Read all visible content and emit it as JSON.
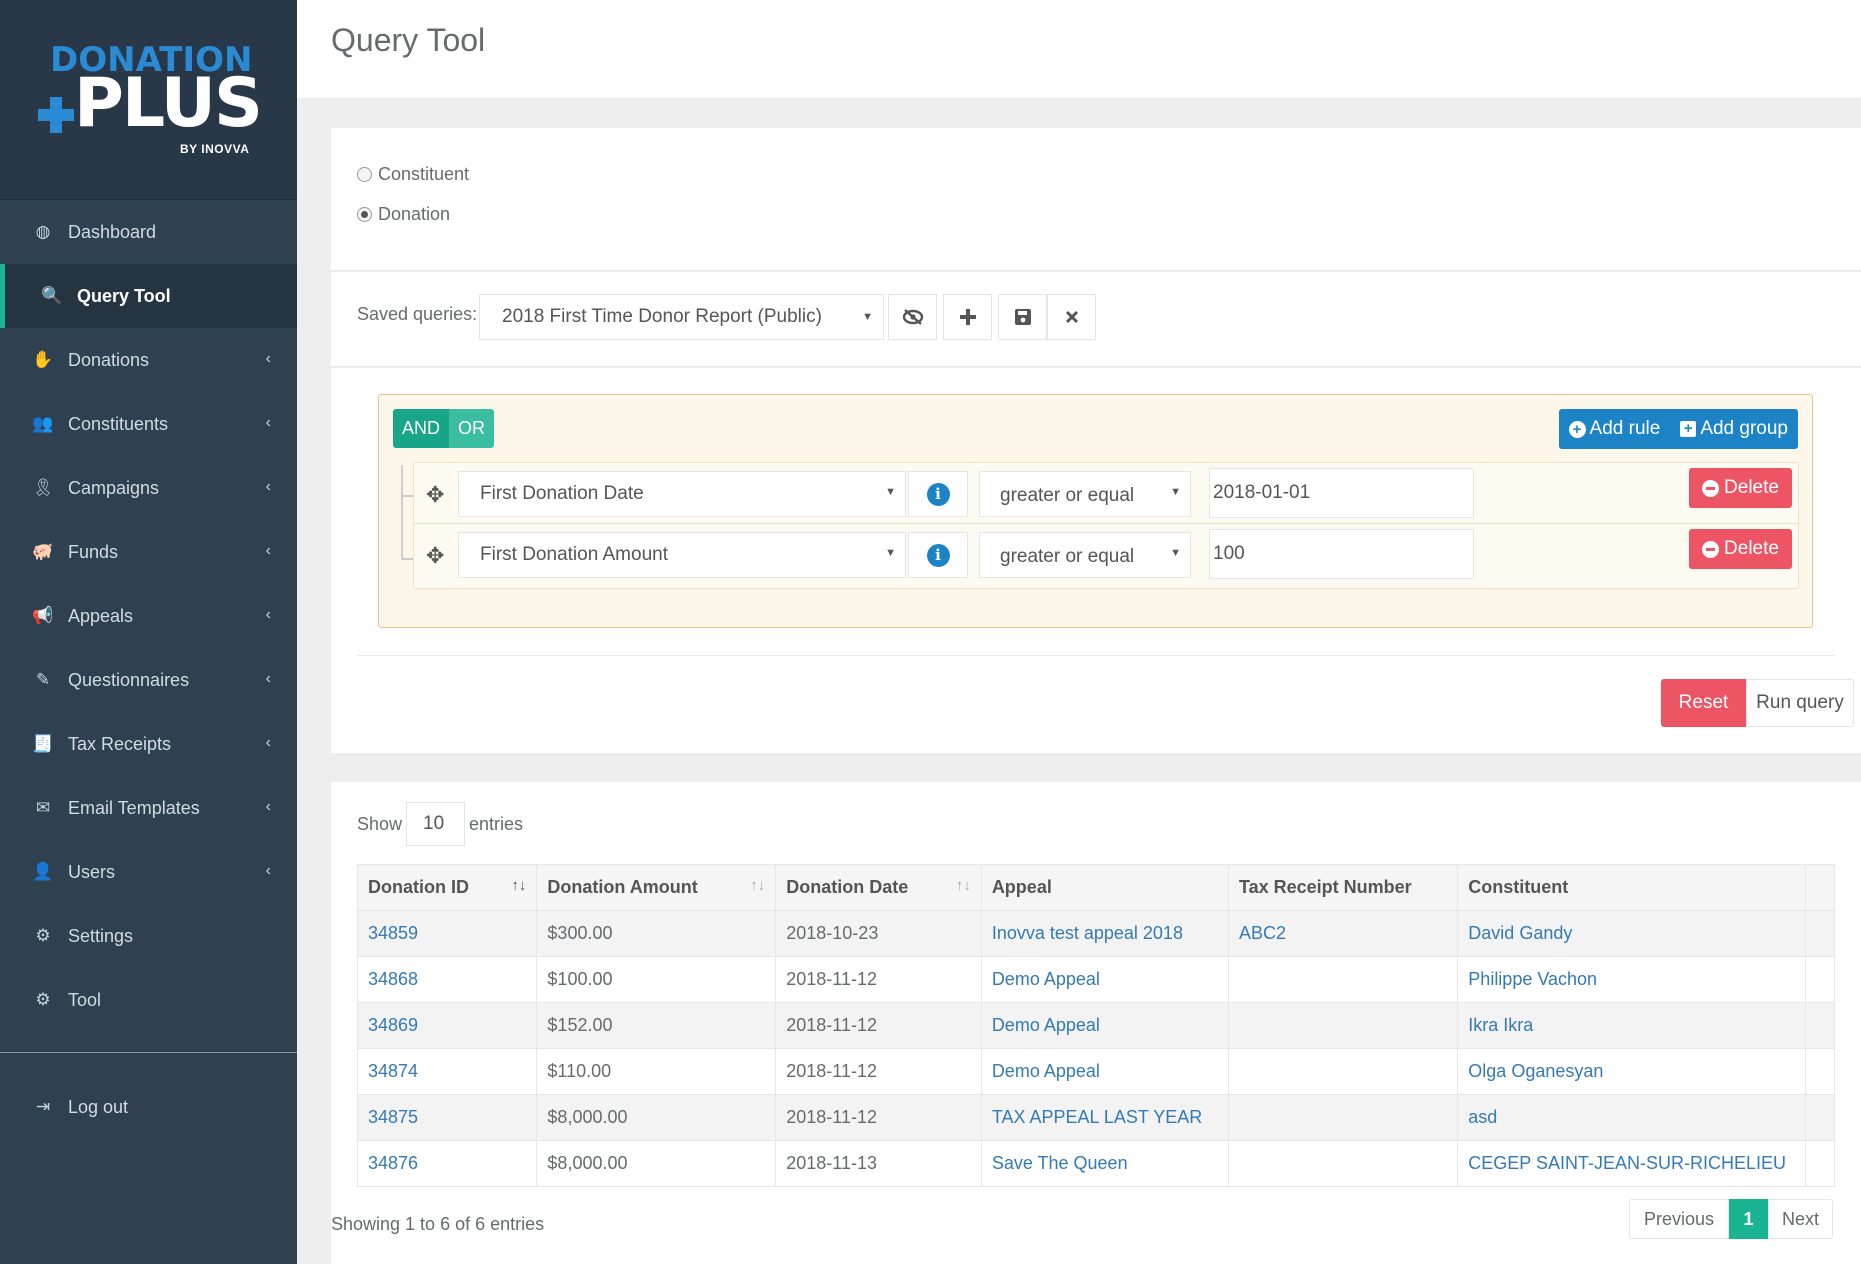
{
  "brand": {
    "line1": "DONATION",
    "line2": "PLUS",
    "byline": "BY INOVVA"
  },
  "sidebar": {
    "items": [
      {
        "label": "Dashboard",
        "icon": "dashboard-icon",
        "glyph": "◍",
        "chevron": false,
        "active": false
      },
      {
        "label": "Query Tool",
        "icon": "search-icon",
        "glyph": "🔍",
        "chevron": false,
        "active": true
      },
      {
        "label": "Donations",
        "icon": "hand-donation-icon",
        "glyph": "✋",
        "chevron": true,
        "active": false
      },
      {
        "label": "Constituents",
        "icon": "users-icon",
        "glyph": "👥",
        "chevron": true,
        "active": false
      },
      {
        "label": "Campaigns",
        "icon": "ribbon-icon",
        "glyph": "🎗",
        "chevron": true,
        "active": false
      },
      {
        "label": "Funds",
        "icon": "piggy-bank-icon",
        "glyph": "🐖",
        "chevron": true,
        "active": false
      },
      {
        "label": "Appeals",
        "icon": "megaphone-icon",
        "glyph": "📢",
        "chevron": true,
        "active": false
      },
      {
        "label": "Questionnaires",
        "icon": "edit-icon",
        "glyph": "✎",
        "chevron": true,
        "active": false
      },
      {
        "label": "Tax Receipts",
        "icon": "receipt-icon",
        "glyph": "🧾",
        "chevron": true,
        "active": false
      },
      {
        "label": "Email Templates",
        "icon": "envelope-open-icon",
        "glyph": "✉",
        "chevron": true,
        "active": false
      },
      {
        "label": "Users",
        "icon": "user-icon",
        "glyph": "👤",
        "chevron": true,
        "active": false
      },
      {
        "label": "Settings",
        "icon": "gear-icon",
        "glyph": "⚙",
        "chevron": false,
        "active": false
      },
      {
        "label": "Tool",
        "icon": "gear-icon",
        "glyph": "⚙",
        "chevron": false,
        "active": false
      }
    ],
    "logout": {
      "label": "Log out",
      "icon": "sign-out-icon",
      "glyph": "⇥"
    }
  },
  "page": {
    "title": "Query Tool"
  },
  "query_type": {
    "options": [
      {
        "label": "Constituent",
        "checked": false
      },
      {
        "label": "Donation",
        "checked": true
      }
    ]
  },
  "saved_queries": {
    "label": "Saved queries:",
    "selected": "2018 First Time Donor Report (Public)",
    "buttons": [
      {
        "name": "toggle-visibility-button",
        "icon": "eye-slash-icon",
        "glyph": "⊘"
      },
      {
        "name": "add-query-button",
        "icon": "plus-icon",
        "glyph": "+"
      },
      {
        "name": "save-query-button",
        "icon": "save-icon",
        "glyph": "💾"
      },
      {
        "name": "delete-query-button",
        "icon": "close-icon",
        "glyph": "✕"
      }
    ]
  },
  "builder": {
    "condition_and": "AND",
    "condition_or": "OR",
    "add_rule": "Add rule",
    "add_group": "Add group",
    "rules": [
      {
        "field": "First Donation Date",
        "operator": "greater or equal",
        "value": "2018-01-01",
        "delete": "Delete"
      },
      {
        "field": "First Donation Amount",
        "operator": "greater or equal",
        "value": "100",
        "delete": "Delete"
      }
    ],
    "reset": "Reset",
    "run": "Run query"
  },
  "table": {
    "show_label": "Show",
    "page_size": "10",
    "entries_label": "entries",
    "columns": [
      "Donation ID",
      "Donation Amount",
      "Donation Date",
      "Appeal",
      "Tax Receipt Number",
      "Constituent"
    ],
    "rows": [
      [
        "34859",
        "$300.00",
        "2018-10-23",
        "Inovva test appeal 2018",
        "ABC2",
        "David Gandy"
      ],
      [
        "34868",
        "$100.00",
        "2018-11-12",
        "Demo Appeal",
        "",
        "Philippe Vachon"
      ],
      [
        "34869",
        "$152.00",
        "2018-11-12",
        "Demo Appeal",
        "",
        "Ikra Ikra"
      ],
      [
        "34874",
        "$110.00",
        "2018-11-12",
        "Demo Appeal",
        "",
        "Olga Oganesyan"
      ],
      [
        "34875",
        "$8,000.00",
        "2018-11-12",
        "TAX APPEAL LAST YEAR",
        "",
        "asd"
      ],
      [
        "34876",
        "$8,000.00",
        "2018-11-13",
        "Save The Queen",
        "",
        "CEGEP SAINT-JEAN-SUR-RICHELIEU"
      ]
    ],
    "summary": "Showing 1 to 6 of 6 entries",
    "pagination": {
      "previous": "Previous",
      "current": "1",
      "next": "Next"
    }
  },
  "colors": {
    "sidebar_bg": "#2f4050",
    "accent_green": "#1ab394",
    "accent_blue": "#1c84c6",
    "danger": "#ed5565",
    "link": "#337ab7"
  }
}
